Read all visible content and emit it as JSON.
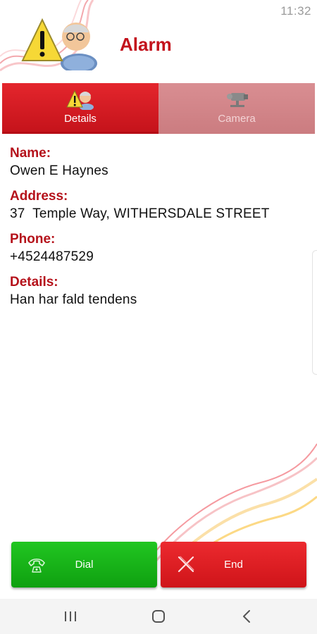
{
  "status_bar": {
    "time": "11:32"
  },
  "header": {
    "title": "Alarm",
    "logo_icon": "alarm-elderly-warning-icon"
  },
  "tabs": [
    {
      "label": "Details",
      "icon": "details-warning-person-icon",
      "active": true
    },
    {
      "label": "Camera",
      "icon": "security-camera-icon",
      "active": false
    }
  ],
  "details": {
    "name_label": "Name:",
    "name_value": "Owen E Haynes",
    "address_label": "Address:",
    "address_value": "37  Temple Way, WITHERSDALE STREET",
    "phone_label": "Phone:",
    "phone_value": "+4524487529",
    "details_label": "Details:",
    "details_value": "Han har fald tendens"
  },
  "actions": {
    "dial_label": "Dial",
    "dial_icon": "phone-icon",
    "end_label": "End",
    "end_icon": "close-x-icon"
  },
  "navbar": {
    "recents_icon": "recent-apps-icon",
    "home_icon": "home-icon",
    "back_icon": "back-icon"
  },
  "colors": {
    "brand_red": "#c3121c",
    "dial_green": "#15aa16",
    "end_red": "#d9181e",
    "label_red": "#b5121b"
  }
}
